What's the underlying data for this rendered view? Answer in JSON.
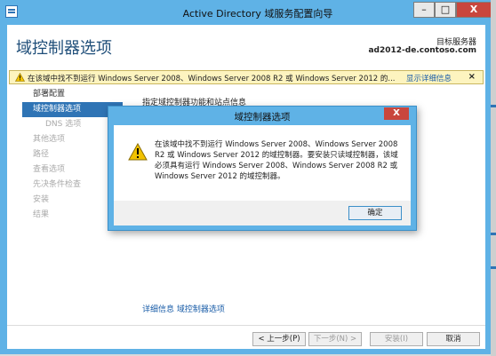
{
  "window": {
    "title": "Active Directory 域服务配置向导",
    "minimize_label": "–",
    "maximize_label": "□",
    "close_label": "X"
  },
  "header": {
    "page_title": "域控制器选项",
    "target_label": "目标服务器",
    "target_server": "ad2012-de.contoso.com"
  },
  "warning_bar": {
    "text": "在该域中找不到运行 Windows Server 2008、Windows Server 2008 R2 或 Windows Server 2012 的...",
    "link": "显示详细信息",
    "close": "×"
  },
  "sidebar": {
    "items": [
      {
        "label": "部署配置",
        "state": "done"
      },
      {
        "label": "域控制器选项",
        "state": "active"
      },
      {
        "label": "DNS 选项",
        "state": "sub"
      },
      {
        "label": "其他选项",
        "state": "pending"
      },
      {
        "label": "路径",
        "state": "pending"
      },
      {
        "label": "查看选项",
        "state": "pending"
      },
      {
        "label": "先决条件检查",
        "state": "pending"
      },
      {
        "label": "安装",
        "state": "pending"
      },
      {
        "label": "结果",
        "state": "pending"
      }
    ]
  },
  "main": {
    "section_title": "指定域控制器功能和站点信息",
    "more_info_link": "详细信息 域控制器选项"
  },
  "buttons": {
    "back": "< 上一步(P)",
    "next": "下一步(N) >",
    "install": "安装(I)",
    "cancel": "取消"
  },
  "dialog": {
    "title": "域控制器选项",
    "close": "X",
    "message": "在该域中找不到运行 Windows Server 2008、Windows Server 2008 R2 或 Windows Server 2012 的域控制器。要安装只读域控制器，该域必须具有运行 Windows Server 2008、Windows Server 2008 R2 或 Windows Server 2012 的域控制器。",
    "ok": "确定"
  }
}
